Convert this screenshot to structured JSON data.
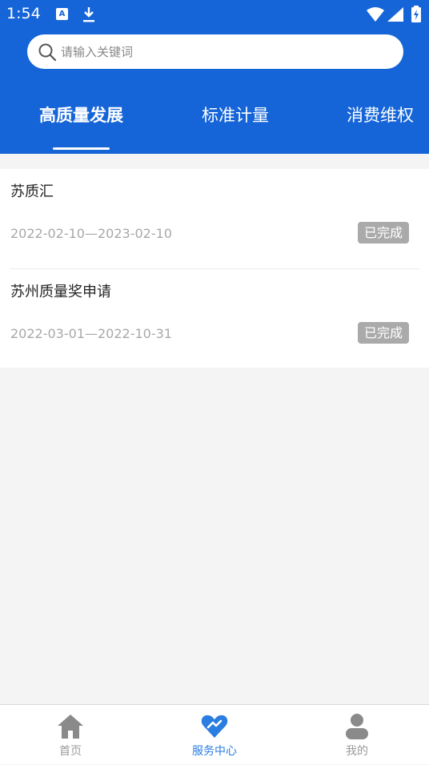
{
  "status_bar": {
    "time": "1:54",
    "icons": [
      "a-icon",
      "download-icon",
      "wifi-icon",
      "signal-icon",
      "battery-icon"
    ]
  },
  "search": {
    "placeholder": "请输入关键词"
  },
  "tabs": [
    {
      "label": "高质量发展",
      "active": true
    },
    {
      "label": "标准计量",
      "active": false
    },
    {
      "label": "消费维权",
      "active": false
    }
  ],
  "items": [
    {
      "title": "苏质汇",
      "date_range": "2022-02-10—2023-02-10",
      "status": "已完成"
    },
    {
      "title": "苏州质量奖申请",
      "date_range": "2022-03-01—2022-10-31",
      "status": "已完成"
    }
  ],
  "bottom_nav": [
    {
      "label": "首页",
      "icon": "home-icon",
      "active": false
    },
    {
      "label": "服务中心",
      "icon": "service-heart-icon",
      "active": true
    },
    {
      "label": "我的",
      "icon": "user-icon",
      "active": false
    }
  ],
  "colors": {
    "primary": "#1565d8",
    "active_nav": "#2a7de1",
    "badge": "#aaaaaa",
    "background": "#f4f4f4"
  }
}
